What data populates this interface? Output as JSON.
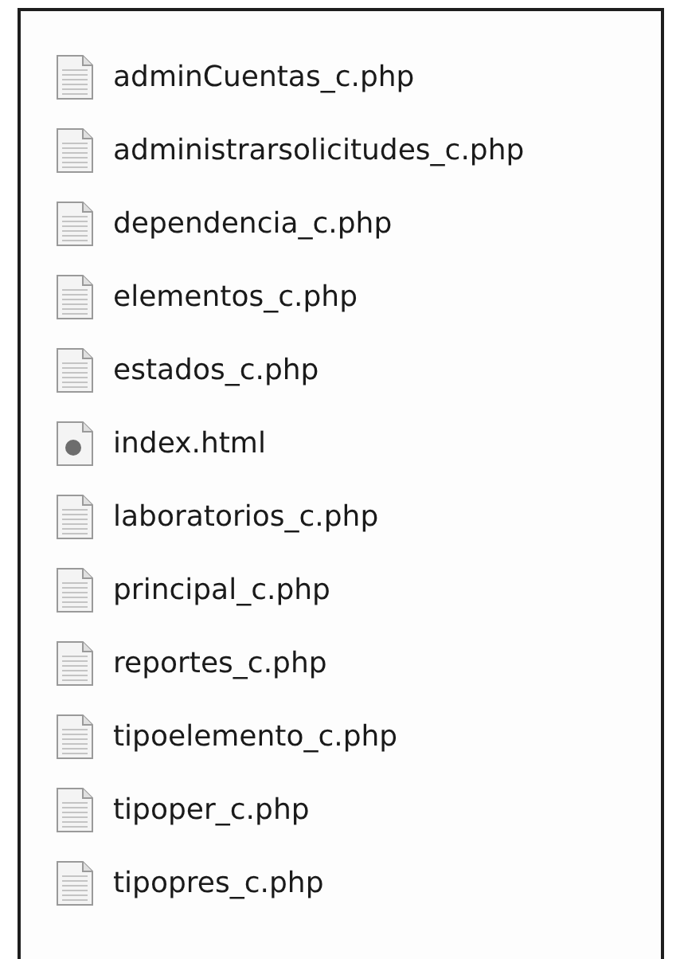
{
  "files": [
    {
      "name": "adminCuentas_c.php",
      "kind": "php"
    },
    {
      "name": "administrarsolicitudes_c.php",
      "kind": "php"
    },
    {
      "name": "dependencia_c.php",
      "kind": "php"
    },
    {
      "name": "elementos_c.php",
      "kind": "php"
    },
    {
      "name": "estados_c.php",
      "kind": "php"
    },
    {
      "name": "index.html",
      "kind": "html"
    },
    {
      "name": "laboratorios_c.php",
      "kind": "php"
    },
    {
      "name": "principal_c.php",
      "kind": "php"
    },
    {
      "name": "reportes_c.php",
      "kind": "php"
    },
    {
      "name": "tipoelemento_c.php",
      "kind": "php"
    },
    {
      "name": "tipoper_c.php",
      "kind": "php"
    },
    {
      "name": "tipopres_c.php",
      "kind": "php"
    }
  ]
}
